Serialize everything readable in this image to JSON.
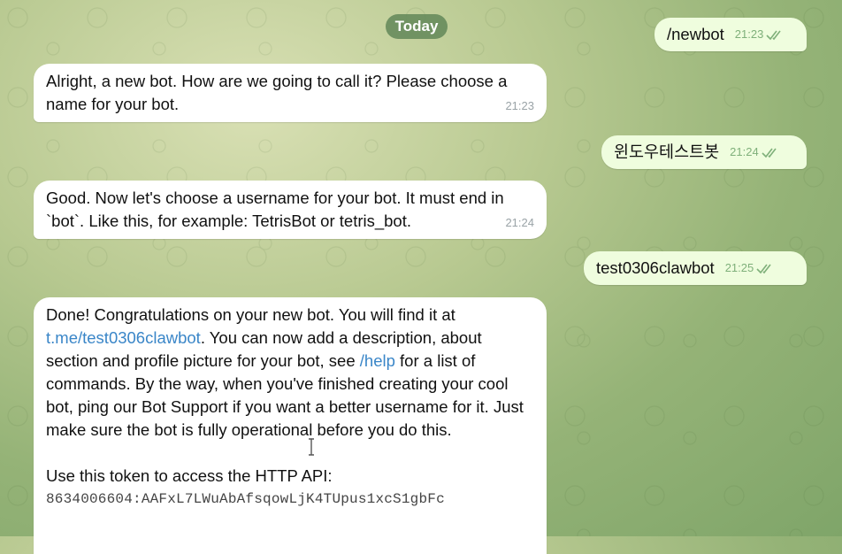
{
  "chat": {
    "date_label": "Today",
    "messages": [
      {
        "id": "m1",
        "direction": "out",
        "text": "/newbot",
        "time": "21:23",
        "is_command": true
      },
      {
        "id": "m2",
        "direction": "in",
        "text": "Alright, a new bot. How are we going to call it? Please choose a name for your bot.",
        "time": "21:23"
      },
      {
        "id": "m3",
        "direction": "out",
        "text": "윈도우테스트봇",
        "time": "21:24"
      },
      {
        "id": "m4",
        "direction": "in",
        "text": "Good. Now let's choose a username for your bot. It must end in `bot`. Like this, for example: TetrisBot or tetris_bot.",
        "time": "21:24"
      },
      {
        "id": "m5",
        "direction": "out",
        "text": "test0306clawbot",
        "time": "21:25"
      },
      {
        "id": "m6",
        "direction": "in",
        "part1": "Done! Congratulations on your new bot. You will find it at ",
        "link": "t.me/test0306clawbot",
        "part2": ". You can now add a description, about section and profile picture for your bot, see ",
        "help_cmd": "/help",
        "part3": " for a list of commands. By the way, when you've finished creating your cool bot, ping our Bot Support if you want a better username for it. Just make sure the bot is fully operational before you do this.",
        "token_intro": "Use this token to access the HTTP API:",
        "token": "8634006604:AAFxL7LWuAbAfsqowLjK4TUpus1xcS1gbFc"
      }
    ]
  },
  "colors": {
    "incoming_bubble": "#ffffff",
    "outgoing_bubble": "#effdde",
    "link": "#3a86c8",
    "read_check": "#7fb07a"
  },
  "icons": {
    "read_receipt": "double-check-icon",
    "text_cursor": "i-beam-cursor-icon"
  }
}
